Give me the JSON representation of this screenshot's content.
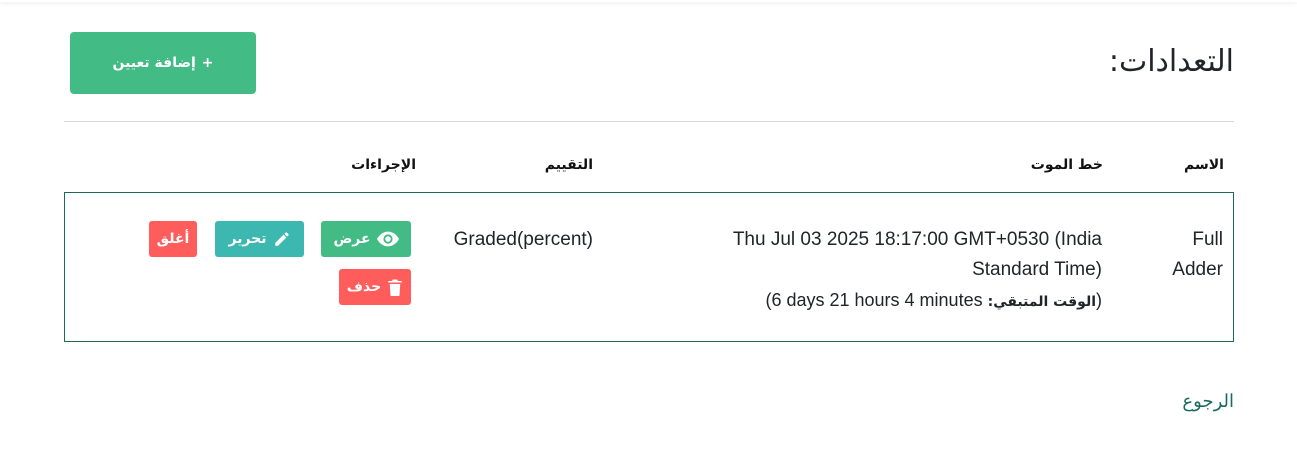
{
  "page": {
    "title": "التعدادات:",
    "back_link": "الرجوع"
  },
  "toolbar": {
    "add_label": "إضافة تعيين",
    "add_icon": "plus-icon"
  },
  "table": {
    "headers": {
      "name": "الاسم",
      "deadline": "خط الموت",
      "grading": "التقييم",
      "actions": "الإجراءات"
    },
    "rows": [
      {
        "name": "Full Adder",
        "deadline": "Thu Jul 03 2025 18:17:00 GMT+0530 (India Standard Time)",
        "remaining_label": "الوقت المتبقي:",
        "remaining_value": "6 days 21 hours 4 minutes",
        "remaining_open": "(",
        "remaining_close": ")",
        "grading": "Graded(percent)",
        "actions": {
          "view": "عرض",
          "edit": "تحرير",
          "close": "أغلق",
          "delete": "حذف"
        }
      }
    ]
  },
  "colors": {
    "primary_green": "#43bb85",
    "teal": "#3cb8b1",
    "danger": "#ff5c5c",
    "border_dark_green": "#1a6b5e"
  }
}
